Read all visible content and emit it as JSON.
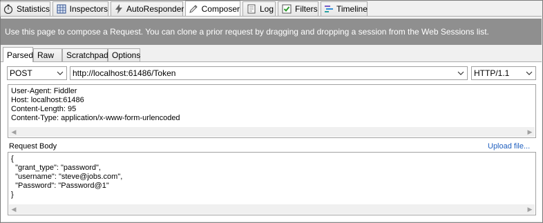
{
  "top_tabs": [
    {
      "label": "Statistics",
      "icon": "stopwatch-icon"
    },
    {
      "label": "Inspectors",
      "icon": "inspect-icon"
    },
    {
      "label": "AutoResponder",
      "icon": "lightning-icon"
    },
    {
      "label": "Composer",
      "icon": "pencil-icon"
    },
    {
      "label": "Log",
      "icon": "log-icon"
    },
    {
      "label": "Filters",
      "icon": "checkbox-icon"
    },
    {
      "label": "Timeline",
      "icon": "timeline-icon"
    }
  ],
  "active_top_tab": "Composer",
  "banner": "Use this page to compose a Request. You can clone a prior request by dragging and dropping a session from the Web Sessions list.",
  "sub_tabs": [
    "Parsed",
    "Raw",
    "Scratchpad",
    "Options"
  ],
  "active_sub_tab": "Parsed",
  "request": {
    "method": "POST",
    "url": "http://localhost:61486/Token",
    "version": "HTTP/1.1"
  },
  "headers_lines": [
    "User-Agent: Fiddler",
    "Host: localhost:61486",
    "Content-Length: 95",
    "Content-Type: application/x-www-form-urlencoded"
  ],
  "body_label": "Request Body",
  "upload_link": "Upload file...",
  "body_lines": [
    "{",
    "  \"grant_type\": \"password\",",
    "  \"username\": \"steve@jobs.com\",",
    "  \"Password\": \"Password@1\"",
    "}"
  ],
  "colors": {
    "banner": "#8f8f8f",
    "link": "#1f5fbf"
  }
}
